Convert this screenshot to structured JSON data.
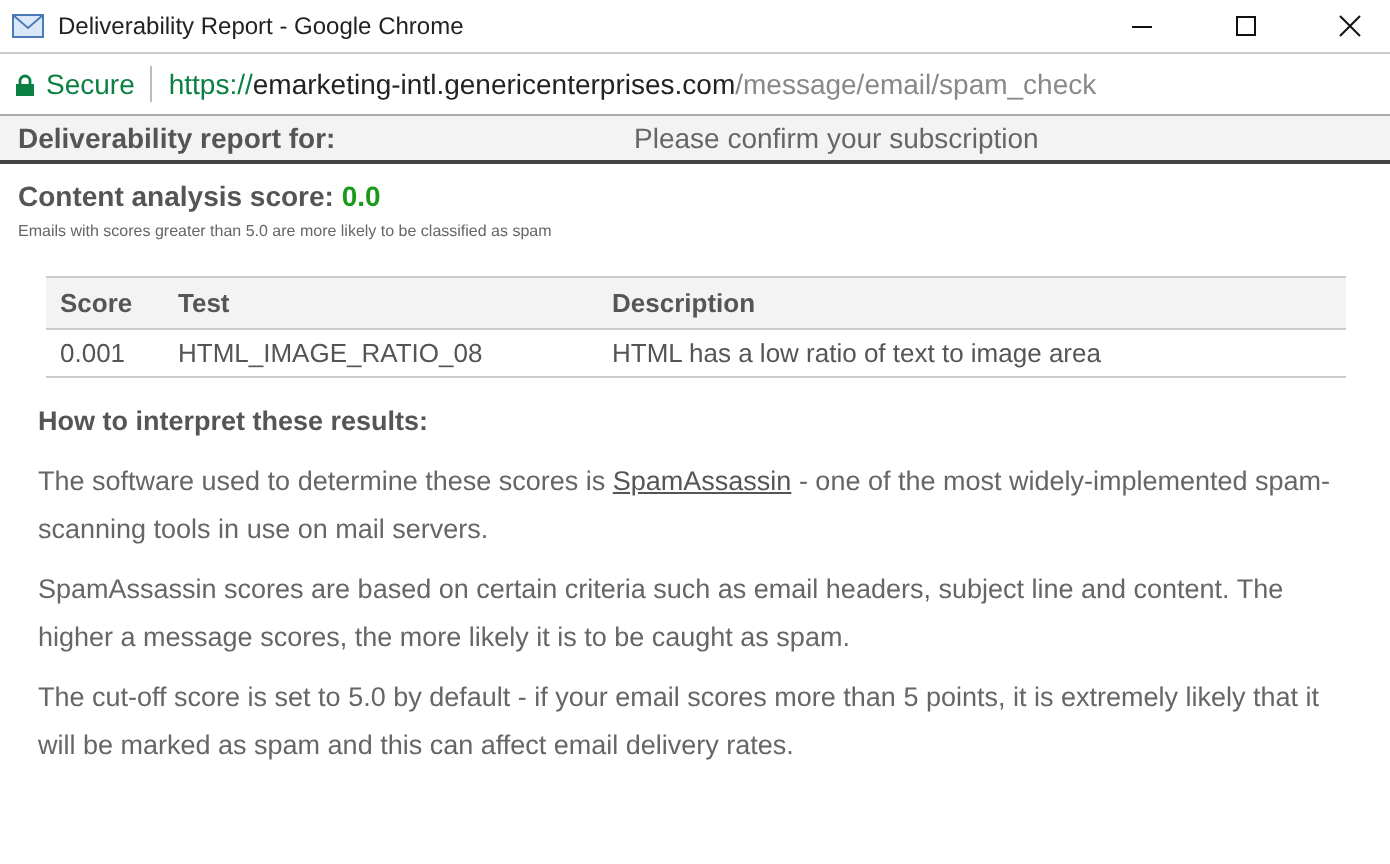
{
  "window": {
    "title": "Deliverability Report - Google Chrome"
  },
  "address_bar": {
    "secure_label": "Secure",
    "scheme": "https://",
    "host": "emarketing-intl.genericenterprises.com",
    "path": "/message/email/spam_check"
  },
  "report_header": {
    "label": "Deliverability report for:",
    "subject": "Please confirm your subscription"
  },
  "score": {
    "label": "Content analysis score:",
    "value": "0.0",
    "note": "Emails with scores greater than 5.0 are more likely to be classified as spam"
  },
  "table": {
    "columns": [
      "Score",
      "Test",
      "Description"
    ],
    "rows": [
      [
        "0.001",
        "HTML_IMAGE_RATIO_08",
        "HTML has a low ratio of text to image area"
      ]
    ]
  },
  "interpret": {
    "heading": "How to interpret these results:",
    "intro": {
      "before": "The software used to determine these scores is",
      "link": "SpamAssassin",
      "after": "- one of the most widely-implemented spam-scanning tools in use on mail servers."
    },
    "paragraphs": [
      "SpamAssassin scores are based on certain criteria such as email headers, subject line and content. The higher a message scores, the more likely it is to be caught as spam.",
      "The cut-off score is set to 5.0 by default - if your email scores more than 5 points, it is extremely likely that it will be marked as spam and this can affect email delivery rates."
    ]
  }
}
